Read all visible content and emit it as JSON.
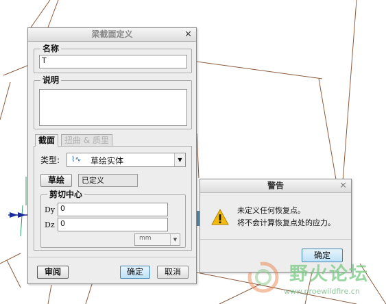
{
  "beam_dialog": {
    "title": "梁截面定义",
    "name_label": "名称",
    "name_value": "T",
    "desc_label": "说明",
    "desc_value": "",
    "tabs": [
      {
        "label": "截面",
        "active": true
      },
      {
        "label": "扭曲 & 质里",
        "active": false
      }
    ],
    "type_label": "类型:",
    "type_value": "草绘实体",
    "type_icon": "sketch-solid-icon",
    "sketch_button": "草绘",
    "sketch_status": "已定义",
    "shear_center": {
      "label": "剪切中心",
      "dy_label": "Dy",
      "dy_value": "0",
      "dz_label": "Dz",
      "dz_value": "0",
      "unit_value": "mm"
    },
    "review_button": "审阅",
    "ok_button": "确定",
    "cancel_button": "取消"
  },
  "warning_dialog": {
    "title": "警告",
    "line1": "未定义任何恢复点。",
    "line2": "将不会计算恢复点处的应力。",
    "ok_button": "确定",
    "icon": "warning-triangle-icon"
  },
  "watermark": {
    "text": "野火论坛",
    "url": "www.proewildfire.cn"
  },
  "colors": {
    "dialog_bg": "#ededed",
    "background_line": "#8b5a3c",
    "default_button_border": "#3c7fb1",
    "warning_yellow": "#f2b90f"
  }
}
